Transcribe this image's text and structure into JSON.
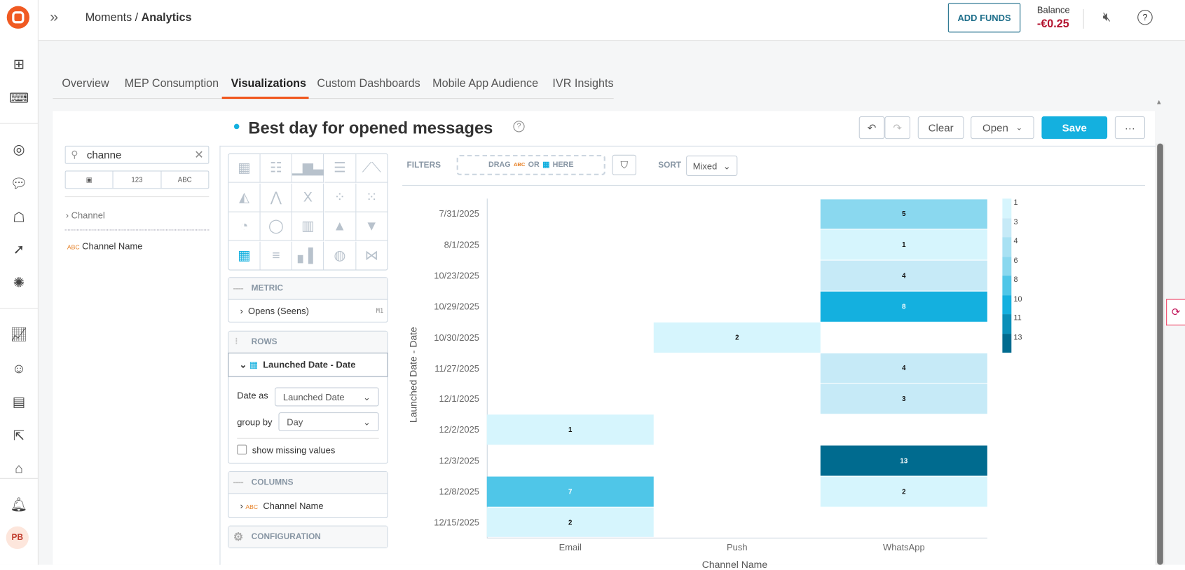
{
  "header": {
    "breadcrumb_parent": "Moments",
    "breadcrumb_sep": " / ",
    "breadcrumb_current": "Analytics",
    "add_funds": "ADD FUNDS",
    "balance_label": "Balance",
    "balance_value": "-€0.25"
  },
  "sidebar": {
    "avatar": "PB"
  },
  "tabs": [
    "Overview",
    "MEP Consumption",
    "Visualizations",
    "Custom Dashboards",
    "Mobile App Audience",
    "IVR Insights"
  ],
  "report": {
    "title": "Best day for opened messages",
    "clear": "Clear",
    "open": "Open",
    "save": "Save",
    "more": "···"
  },
  "fields": {
    "search_value": "channe",
    "type_num": "123",
    "type_abc": "ABC",
    "group": "Channel",
    "field_prefix": "ABC",
    "field": "Channel Name"
  },
  "config": {
    "metric_label": "METRIC",
    "metric": "Opens (Seens)",
    "metric_tag": "M1",
    "rows_label": "ROWS",
    "row_field": "Launched Date - Date",
    "date_as_label": "Date as",
    "date_as": "Launched Date",
    "group_by_label": "group by",
    "group_by": "Day",
    "show_missing": "show missing values",
    "columns_label": "COLUMNS",
    "column_prefix": "ABC",
    "column_field": "Channel Name",
    "configuration_label": "CONFIGURATION"
  },
  "toolbar": {
    "filters": "FILTERS",
    "drag_prefix": "DRAG",
    "drag_abc": "ABC",
    "drag_or": "OR",
    "drag_here": "HERE",
    "sort": "SORT",
    "sort_value": "Mixed"
  },
  "chart_data": {
    "type": "heatmap",
    "xlabel": "Channel Name",
    "ylabel": "Launched Date - Date",
    "x_categories": [
      "Email",
      "Push",
      "WhatsApp"
    ],
    "y_categories": [
      "7/31/2025",
      "8/1/2025",
      "10/23/2025",
      "10/29/2025",
      "10/30/2025",
      "11/27/2025",
      "12/1/2025",
      "12/2/2025",
      "12/3/2025",
      "12/8/2025",
      "12/15/2025"
    ],
    "values": [
      [
        null,
        null,
        5
      ],
      [
        null,
        null,
        1
      ],
      [
        null,
        null,
        4
      ],
      [
        null,
        null,
        8
      ],
      [
        null,
        2,
        null
      ],
      [
        null,
        null,
        4
      ],
      [
        null,
        null,
        3
      ],
      [
        1,
        null,
        null
      ],
      [
        null,
        null,
        13
      ],
      [
        7,
        null,
        2
      ],
      [
        2,
        null,
        null
      ]
    ],
    "legend": [
      "1",
      "3",
      "4",
      "6",
      "8",
      "10",
      "11",
      "13"
    ],
    "colors": {
      "1": "#d6f5fd",
      "2": "#d6f5fd",
      "3": "#c6eaf7",
      "4": "#c6eaf7",
      "5": "#8ad8ef",
      "7": "#4fc6e8",
      "8": "#14b0df",
      "13": "#006b8f"
    },
    "legend_colors": [
      "#d6f5fd",
      "#c6eaf7",
      "#a8e1f3",
      "#8ad8ef",
      "#4fc6e8",
      "#14b0df",
      "#0a8fb8",
      "#006b8f"
    ]
  }
}
